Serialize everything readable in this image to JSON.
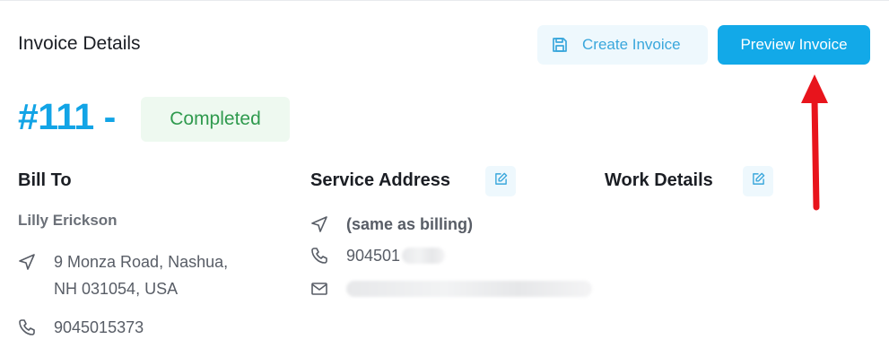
{
  "header": {
    "title": "Invoice Details",
    "create_label": "Create Invoice",
    "preview_label": "Preview Invoice"
  },
  "invoice": {
    "number": "#111 -",
    "status": "Completed"
  },
  "bill_to": {
    "heading": "Bill To",
    "name": "Lilly Erickson",
    "address_line1": "9 Monza Road, Nashua,",
    "address_line2": "NH 031054, USA",
    "phone": "9045015373"
  },
  "service_address": {
    "heading": "Service Address",
    "address": "(same as billing)",
    "phone_visible": "904501"
  },
  "work_details": {
    "heading": "Work Details"
  },
  "colors": {
    "accent": "#12a9e8",
    "status_green": "#2f9a4e",
    "annotation_arrow": "#e8141c"
  },
  "icons": {
    "create": "save-icon",
    "edit": "edit-icon",
    "location": "navigation-arrow-icon",
    "phone": "phone-icon",
    "email": "mail-icon"
  }
}
